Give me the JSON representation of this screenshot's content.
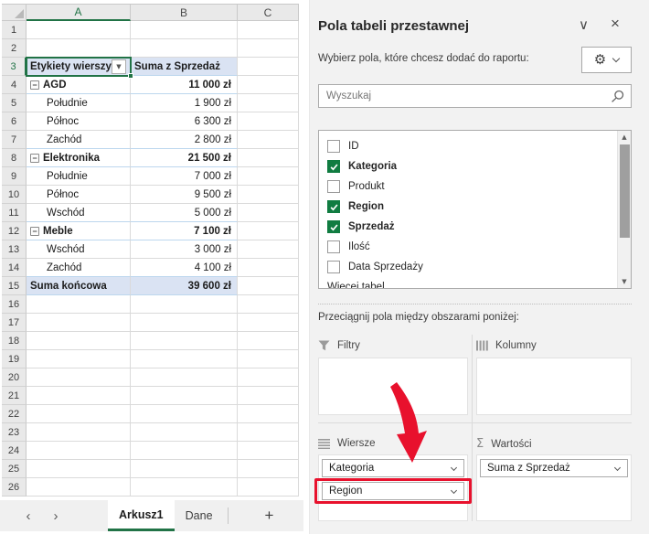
{
  "colors": {
    "excel_green": "#217346",
    "checkbox_green": "#107C41",
    "pivot_header_fill": "#DAE3F3",
    "pivot_border_blue": "#BDD7EE",
    "annotation_red": "#E8112D"
  },
  "icons": {
    "prev": "‹",
    "next": "›",
    "plus": "+",
    "collapse": "−",
    "filter_dropdown": "▼",
    "scroll_up": "▲",
    "scroll_down": "▼",
    "gear": "⚙",
    "sigma": "Σ",
    "panel_collapse": "∨",
    "panel_close": "×"
  },
  "spreadsheet": {
    "columns": [
      "A",
      "B",
      "C"
    ],
    "selected_column": "A",
    "row_count": 26,
    "active_cell_row": 3,
    "pivot": {
      "header": {
        "row": 3,
        "label": "Etykiety wierszy",
        "value_header": "Suma z Sprzedaż"
      },
      "rows": [
        {
          "row": 4,
          "label": "AGD",
          "value": "11 000 zł",
          "type": "category"
        },
        {
          "row": 5,
          "label": "Południe",
          "value": "1 900 zł",
          "type": "item"
        },
        {
          "row": 6,
          "label": "Północ",
          "value": "6 300 zł",
          "type": "item"
        },
        {
          "row": 7,
          "label": "Zachód",
          "value": "2 800 zł",
          "type": "item"
        },
        {
          "row": 8,
          "label": "Elektronika",
          "value": "21 500 zł",
          "type": "category"
        },
        {
          "row": 9,
          "label": "Południe",
          "value": "7 000 zł",
          "type": "item"
        },
        {
          "row": 10,
          "label": "Północ",
          "value": "9 500 zł",
          "type": "item"
        },
        {
          "row": 11,
          "label": "Wschód",
          "value": "5 000 zł",
          "type": "item"
        },
        {
          "row": 12,
          "label": "Meble",
          "value": "7 100 zł",
          "type": "category"
        },
        {
          "row": 13,
          "label": "Wschód",
          "value": "3 000 zł",
          "type": "item"
        },
        {
          "row": 14,
          "label": "Zachód",
          "value": "4 100 zł",
          "type": "item"
        },
        {
          "row": 15,
          "label": "Suma końcowa",
          "value": "39 600 zł",
          "type": "grand_total"
        }
      ]
    },
    "sheet_tabs": {
      "active": "Arkusz1",
      "tabs": [
        "Arkusz1",
        "Dane"
      ]
    }
  },
  "panel": {
    "title": "Pola tabeli przestawnej",
    "subtitle": "Wybierz pola, które chcesz dodać do raportu:",
    "search_placeholder": "Wyszukaj",
    "fields": [
      {
        "label": "ID",
        "checked": false
      },
      {
        "label": "Kategoria",
        "checked": true
      },
      {
        "label": "Produkt",
        "checked": false
      },
      {
        "label": "Region",
        "checked": true
      },
      {
        "label": "Sprzedaż",
        "checked": true
      },
      {
        "label": "Ilość",
        "checked": false
      },
      {
        "label": "Data Sprzedaży",
        "checked": false
      }
    ],
    "more_tables_label": "Więcej tabel",
    "drag_hint": "Przeciągnij pola między obszarami poniżej:",
    "areas": {
      "filters": {
        "label": "Filtry",
        "items": []
      },
      "columns": {
        "label": "Kolumny",
        "items": []
      },
      "rows": {
        "label": "Wiersze",
        "items": [
          "Kategoria",
          "Region"
        ],
        "highlighted_item": "Region"
      },
      "values": {
        "label": "Wartości",
        "items": [
          "Suma z Sprzedaż"
        ]
      }
    }
  }
}
